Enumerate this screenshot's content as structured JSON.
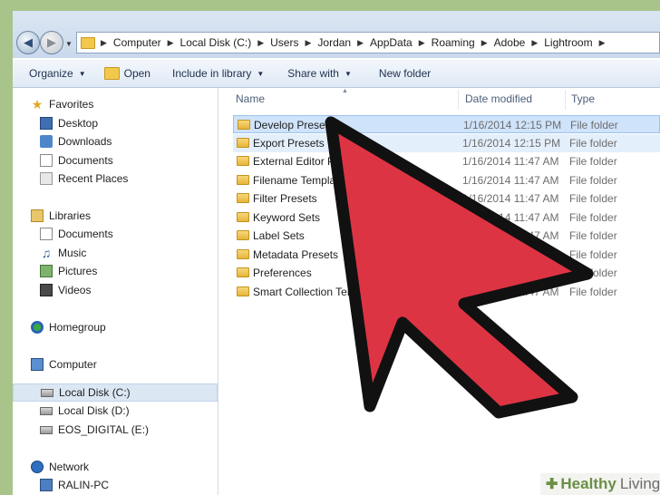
{
  "address": {
    "crumbs": [
      "Computer",
      "Local Disk (C:)",
      "Users",
      "Jordan",
      "AppData",
      "Roaming",
      "Adobe",
      "Lightroom"
    ]
  },
  "toolbar": {
    "organize": "Organize",
    "open": "Open",
    "include": "Include in library",
    "share": "Share with",
    "new_folder": "New folder"
  },
  "sidebar": {
    "favorites": "Favorites",
    "desktop": "Desktop",
    "downloads": "Downloads",
    "documents": "Documents",
    "recent": "Recent Places",
    "libraries": "Libraries",
    "lib_documents": "Documents",
    "music": "Music",
    "pictures": "Pictures",
    "videos": "Videos",
    "homegroup": "Homegroup",
    "computer": "Computer",
    "disk_c": "Local Disk (C:)",
    "disk_d": "Local Disk (D:)",
    "eos": "EOS_DIGITAL (E:)",
    "network": "Network",
    "ralin": "RALIN-PC"
  },
  "columns": {
    "name": "Name",
    "date": "Date modified",
    "type": "Type"
  },
  "files": [
    {
      "name": "Develop Presets",
      "date": "1/16/2014 12:15 PM",
      "type": "File folder"
    },
    {
      "name": "Export Presets",
      "date": "1/16/2014 12:15 PM",
      "type": "File folder"
    },
    {
      "name": "External Editor Presets",
      "date": "1/16/2014 11:47 AM",
      "type": "File folder"
    },
    {
      "name": "Filename Template Presets",
      "date": "1/16/2014 11:47 AM",
      "type": "File folder"
    },
    {
      "name": "Filter Presets",
      "date": "1/16/2014 11:47 AM",
      "type": "File folder"
    },
    {
      "name": "Keyword Sets",
      "date": "1/16/2014 11:47 AM",
      "type": "File folder"
    },
    {
      "name": "Label Sets",
      "date": "1/16/2014 11:47 AM",
      "type": "File folder"
    },
    {
      "name": "Metadata Presets",
      "date": "1/16/2014 11:47 AM",
      "type": "File folder"
    },
    {
      "name": "Preferences",
      "date": "1/16/2014 12:15 PM",
      "type": "File folder"
    },
    {
      "name": "Smart Collection Templates",
      "date": "1/16/2014 11:47 AM",
      "type": "File folder"
    }
  ],
  "colors": {
    "arrow_fill": "#dd3444",
    "arrow_outline": "#111111",
    "selection": "#cfe3fa"
  },
  "brand": {
    "name": "Healthy",
    "suffix": "Living"
  }
}
